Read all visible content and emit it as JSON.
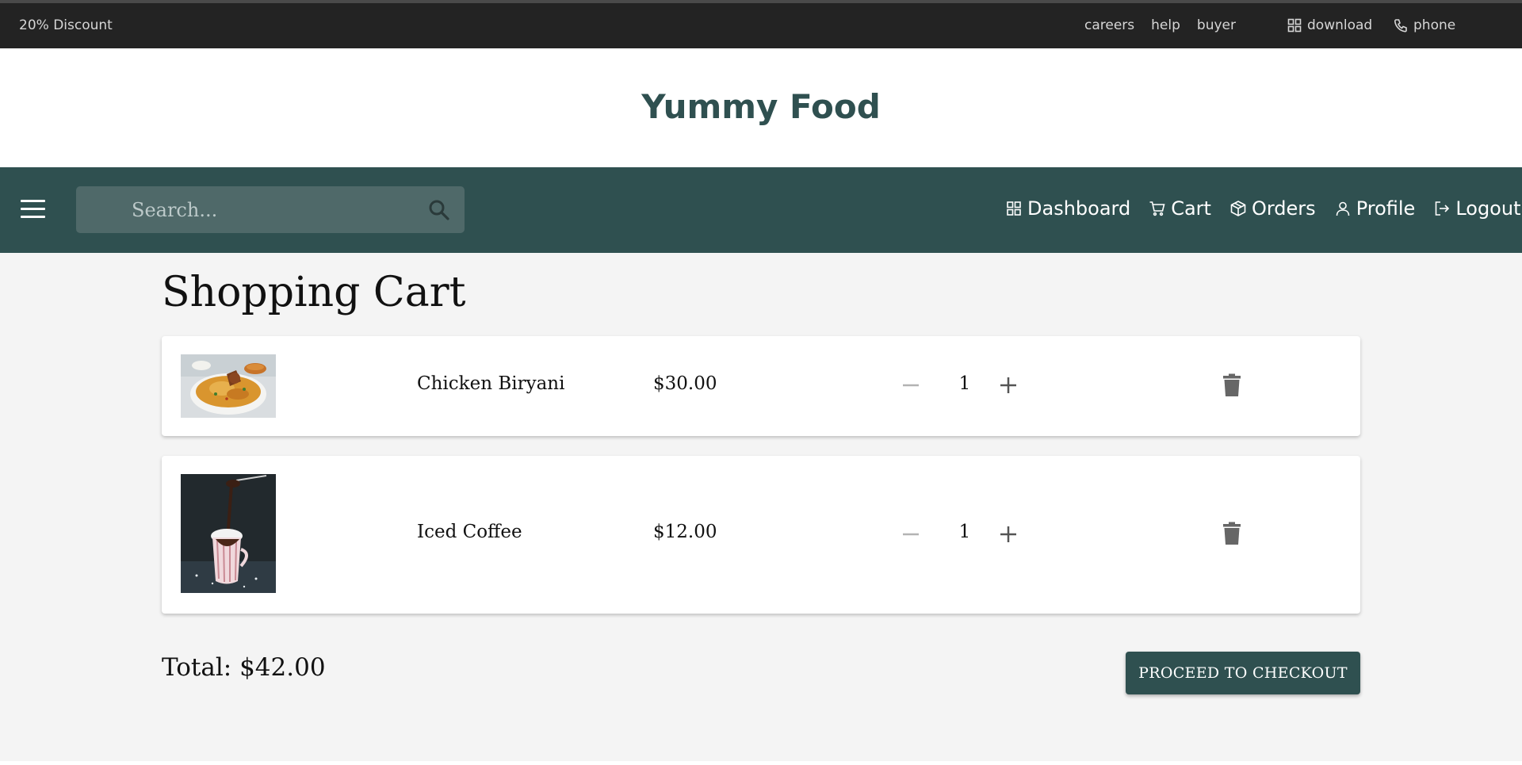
{
  "topbar": {
    "discount": "20% Discount",
    "links": [
      "careers",
      "help",
      "buyer"
    ],
    "download": "download",
    "phone": "phone"
  },
  "brand": {
    "title": "Yummy Food"
  },
  "nav": {
    "search_placeholder": "Search...",
    "links": [
      {
        "label": "Dashboard",
        "icon": "dashboard-icon"
      },
      {
        "label": "Cart",
        "icon": "cart-icon"
      },
      {
        "label": "Orders",
        "icon": "box-icon"
      },
      {
        "label": "Profile",
        "icon": "user-icon"
      },
      {
        "label": "Logout",
        "icon": "logout-icon"
      }
    ]
  },
  "cart": {
    "title": "Shopping Cart",
    "items": [
      {
        "name": "Chicken Biryani",
        "price": "$30.00",
        "quantity": "1",
        "image": "chicken-biryani-photo"
      },
      {
        "name": "Iced Coffee",
        "price": "$12.00",
        "quantity": "1",
        "image": "iced-coffee-photo"
      }
    ],
    "total": "Total: $42.00",
    "checkout_label": "PROCEED TO CHECKOUT"
  },
  "colors": {
    "topbar_bg": "#232323",
    "brand_text": "#2f5050",
    "nav_bg": "#2f5050",
    "main_bg": "#f4f4f4",
    "button_bg": "#2f5050"
  }
}
